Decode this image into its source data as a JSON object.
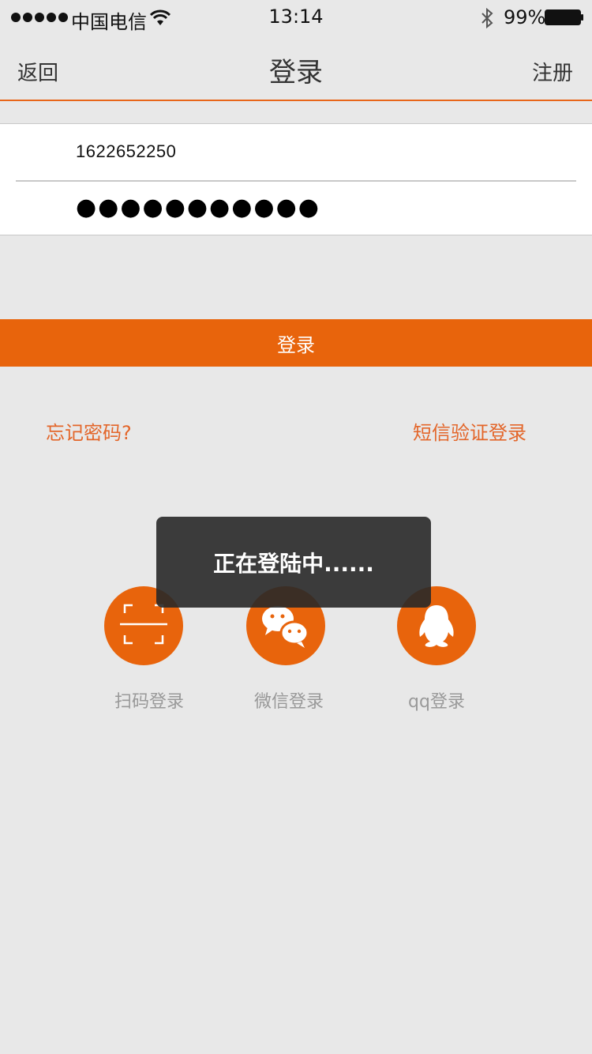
{
  "status_bar": {
    "carrier": "中国电信",
    "time": "13:14",
    "battery": "99%"
  },
  "nav": {
    "back_label": "返回",
    "title": "登录",
    "register_label": "注册"
  },
  "form": {
    "phone_value": "1622652250",
    "password_mask": "●●●●●●●●●●●"
  },
  "login_button_label": "登录",
  "links": {
    "forgot_password": "忘记密码?",
    "sms_login": "短信验证登录"
  },
  "social": [
    {
      "label": "扫码登录",
      "icon": "scan-icon"
    },
    {
      "label": "微信登录",
      "icon": "wechat-icon"
    },
    {
      "label": "qq登录",
      "icon": "qq-icon"
    }
  ],
  "toast": {
    "message": "正在登陆中......"
  },
  "colors": {
    "accent": "#e8640c",
    "link": "#e3662a",
    "background": "#e8e8e8"
  }
}
